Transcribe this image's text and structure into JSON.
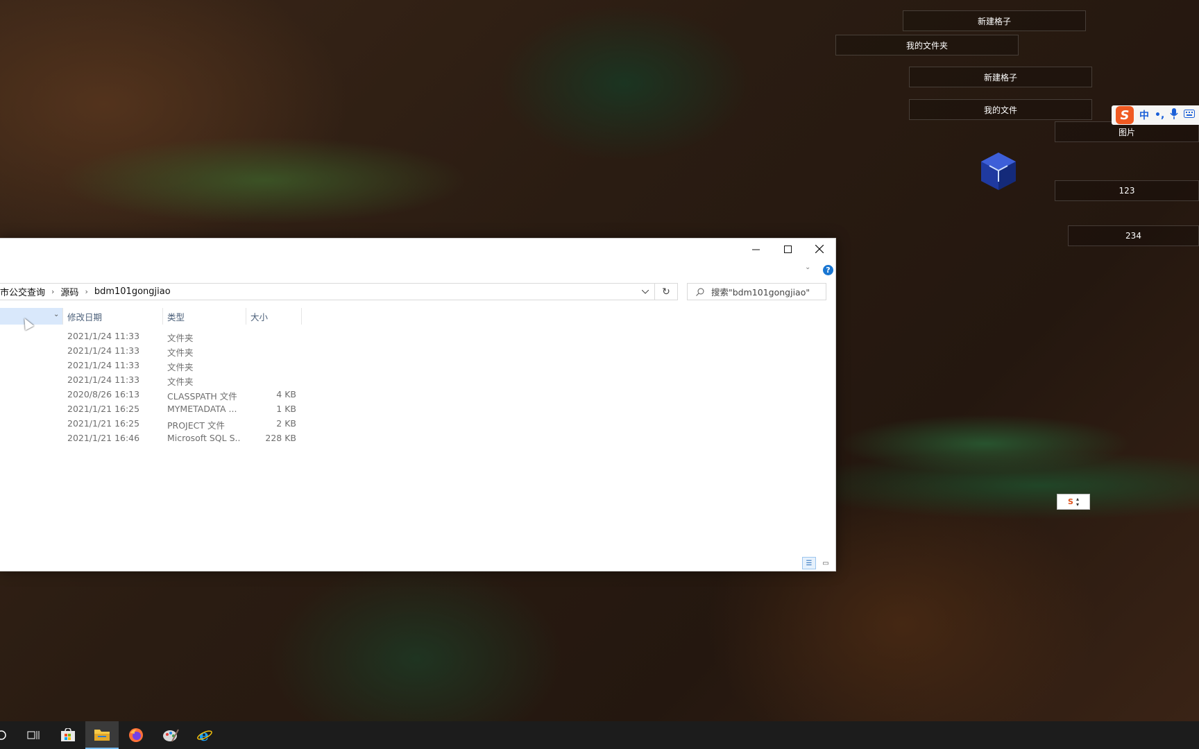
{
  "desktop": {
    "fences": [
      {
        "label": "新建格子"
      },
      {
        "label": "我的文件夹"
      },
      {
        "label": "新建格子"
      },
      {
        "label": "我的文件"
      },
      {
        "label": "图片"
      },
      {
        "label": "123"
      },
      {
        "label": "234"
      }
    ],
    "icons": [
      "cube-app-icon"
    ]
  },
  "ime": {
    "logo": "S",
    "mode": "中",
    "punct": "•,",
    "mini_logo": "S"
  },
  "explorer": {
    "breadcrumb": [
      "市公交查询",
      "源码",
      "bdm101gongjiao"
    ],
    "search_placeholder": "搜索\"bdm101gongjiao\"",
    "columns": {
      "date": "修改日期",
      "type": "类型",
      "size": "大小"
    },
    "rows": [
      {
        "date": "2021/1/24 11:33",
        "type": "文件夹",
        "size": ""
      },
      {
        "date": "2021/1/24 11:33",
        "type": "文件夹",
        "size": ""
      },
      {
        "date": "2021/1/24 11:33",
        "type": "文件夹",
        "size": ""
      },
      {
        "date": "2021/1/24 11:33",
        "type": "文件夹",
        "size": ""
      },
      {
        "date": "2020/8/26 16:13",
        "type": "CLASSPATH 文件",
        "size": "4 KB"
      },
      {
        "date": "2021/1/21 16:25",
        "type": "MYMETADATA ...",
        "size": "1 KB"
      },
      {
        "date": "2021/1/21 16:25",
        "type": "PROJECT 文件",
        "size": "2 KB"
      },
      {
        "date": "2021/1/21 16:46",
        "type": "Microsoft SQL S...",
        "size": "228 KB"
      }
    ]
  },
  "taskbar": {
    "items": [
      "search-icon",
      "task-view-icon",
      "store-icon",
      "file-explorer-icon",
      "firefox-icon",
      "paint-icon",
      "ie-icon"
    ],
    "active": "file-explorer-icon"
  }
}
